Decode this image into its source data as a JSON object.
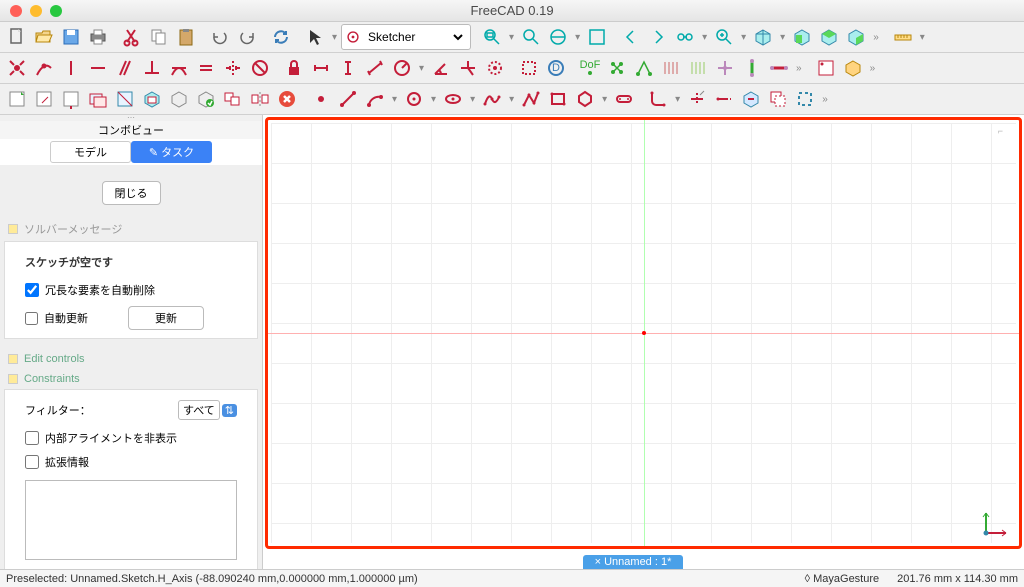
{
  "window": {
    "title": "FreeCAD 0.19"
  },
  "workbench": {
    "selected": "Sketcher"
  },
  "sidebar": {
    "title": "コンボビュー",
    "tabs": {
      "model": "モデル",
      "task": "タスク"
    },
    "close_btn": "閉じる",
    "solver_header": "ソルバーメッセージ",
    "sketch_empty": "スケッチが空です",
    "auto_delete": "冗長な要素を自動削除",
    "auto_update": "自動更新",
    "update_btn": "更新",
    "edit_controls": "Edit controls",
    "constraints": "Constraints",
    "filter_label": "フィルター：",
    "filter_value": "すべて",
    "hide_alignment": "内部アライメントを非表示",
    "ext_info": "拡張情報"
  },
  "doc_tab": {
    "close": "×",
    "name": "Unnamed : 1*"
  },
  "status": {
    "preselected": "Preselected: Unnamed.Sketch.H_Axis (-88.090240 mm,0.000000 mm,1.000000 µm)",
    "nav_style": "MayaGesture",
    "dimensions": "201.76 mm x 114.30 mm"
  },
  "colors": {
    "close": "#ff5f57",
    "min": "#febc2e",
    "max": "#28c840"
  }
}
